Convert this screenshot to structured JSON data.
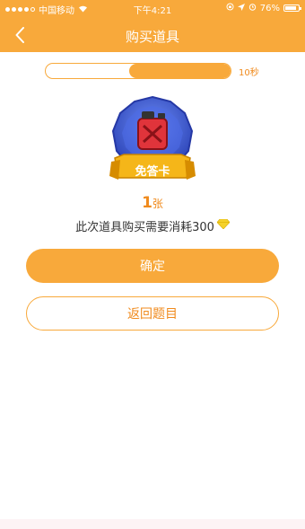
{
  "status_bar": {
    "carrier": "中国移动",
    "time": "下午4:21",
    "battery": "76%"
  },
  "header": {
    "title": "购买道具"
  },
  "timer": {
    "label": "10秒",
    "progress_fraction": 0.55
  },
  "item": {
    "badge_text": "免答卡",
    "count": "1",
    "unit": "张"
  },
  "cost": {
    "text": "此次道具购买需要消耗300"
  },
  "buttons": {
    "confirm": "确定",
    "return": "返回题目"
  },
  "colors": {
    "accent": "#f8a93b",
    "accent_text": "#f08a1c",
    "badge_blue": "#3b5cd6",
    "badge_ribbon": "#f5b619",
    "fuel_can_red": "#e0343b",
    "diamond": "#f5d22a"
  }
}
